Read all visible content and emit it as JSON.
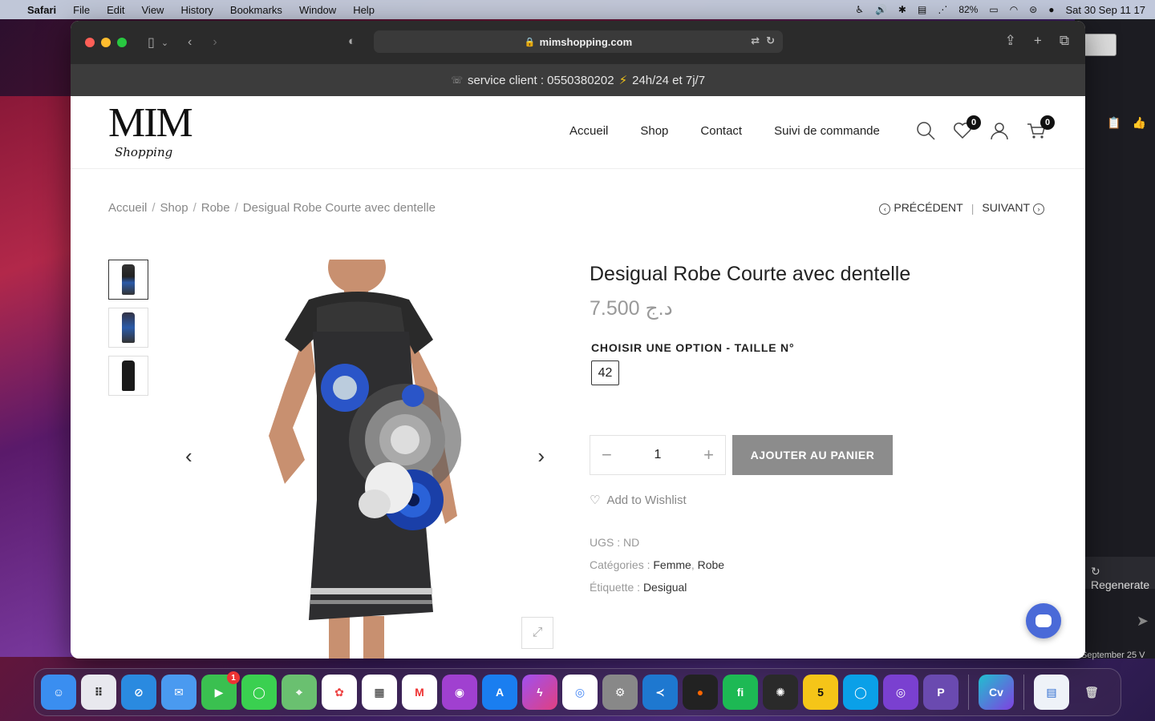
{
  "menubar": {
    "app": "Safari",
    "items": [
      "File",
      "Edit",
      "View",
      "History",
      "Bookmarks",
      "Window",
      "Help"
    ],
    "battery": "82%",
    "clock": "Sat 30 Sep  11 17"
  },
  "browser": {
    "url": "mimshopping.com"
  },
  "site": {
    "topbar": {
      "service": "service client : 0550380202",
      "hours": "24h/24 et 7j/7"
    },
    "logo": {
      "main": "MIM",
      "sub": "Shopping"
    },
    "nav": [
      "Accueil",
      "Shop",
      "Contact",
      "Suivi de commande"
    ],
    "wishlist_count": "0",
    "cart_count": "0"
  },
  "breadcrumb": [
    "Accueil",
    "Shop",
    "Robe",
    "Desigual Robe Courte avec dentelle"
  ],
  "pager": {
    "prev": "PRÉCÉDENT",
    "next": "SUIVANT"
  },
  "product": {
    "title": "Desigual Robe Courte avec dentelle",
    "price": "7.500 د.ج",
    "option_label": "CHOISIR UNE OPTION - TAILLE N°",
    "size": "42",
    "quantity": "1",
    "add_to_cart": "AJOUTER AU PANIER",
    "wishlist": "Add to Wishlist",
    "sku_label": "UGS :",
    "sku": "ND",
    "categories_label": "Catégories :",
    "categories": [
      "Femme",
      "Robe"
    ],
    "tag_label": "Étiquette :",
    "tag": "Desigual"
  },
  "desktop": {
    "regenerate": "Regenerate",
    "footer_note": "September 25 V"
  },
  "colors": {
    "topbar_bg": "#3c3c3c",
    "button_bg": "#8c8c8c",
    "chat_button": "#4a6ad8",
    "badge_bg": "#111111"
  }
}
